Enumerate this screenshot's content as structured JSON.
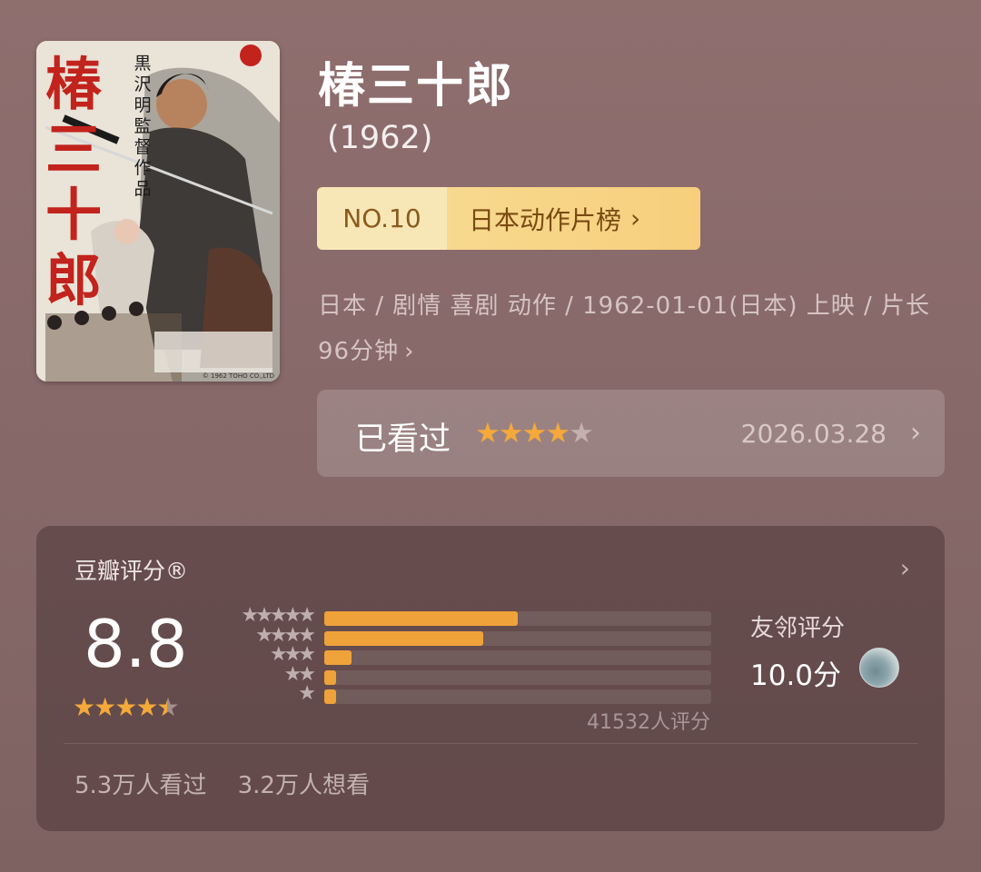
{
  "movie": {
    "title": "椿三十郎",
    "year": "(1962)",
    "poster": {
      "title_vertical": "椿三十郎",
      "credit_vertical": "黒沢明監督作品",
      "copyright": "© 1962 TOHO CO.,LTD"
    },
    "rank": {
      "number": "NO.10",
      "list_name": "日本动作片榜",
      "chevron": "›"
    },
    "meta": {
      "text": "日本 / 剧情 喜剧 动作 / 1962-01-01(日本) 上映 / 片长96分钟",
      "chevron": "›"
    }
  },
  "watched": {
    "label": "已看过",
    "stars": 4,
    "max_stars": 5,
    "date": "2026.03.28",
    "chevron": "›"
  },
  "douban": {
    "title": "豆瓣评分®",
    "chevron": "›",
    "score": "8.8",
    "score_stars": 4.5,
    "distribution": [
      {
        "stars": "★★★★★",
        "fraction": 0.5
      },
      {
        "stars": "★★★★",
        "fraction": 0.41
      },
      {
        "stars": "★★★",
        "fraction": 0.07
      },
      {
        "stars": "★★",
        "fraction": 0.03
      },
      {
        "stars": "★",
        "fraction": 0.03
      }
    ],
    "rating_count": "41532人评分",
    "friends": {
      "label": "友邻评分",
      "score": "10.0分"
    },
    "stats": {
      "watched": "5.3万人看过",
      "want": "3.2万人想看"
    }
  },
  "colors": {
    "accent": "#f0a23a",
    "rank_bg": "#f8e7b6",
    "card_bg": "#4b3434"
  },
  "icons": [
    "chevron-right-icon",
    "star-icon",
    "friend-avatar"
  ]
}
